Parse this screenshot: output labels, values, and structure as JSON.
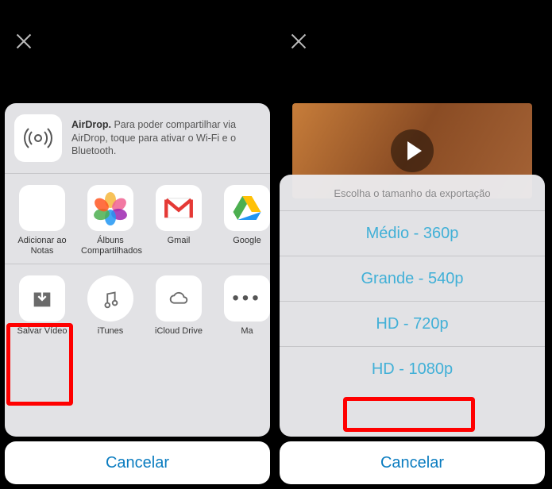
{
  "left": {
    "airdrop_bold": "AirDrop.",
    "airdrop_text": " Para poder compartilhar via AirDrop, toque para ativar o Wi-Fi e o Bluetooth.",
    "share_row": [
      {
        "name": "notes",
        "label": "Adicionar ao Notas"
      },
      {
        "name": "photos",
        "label": "Álbuns Compartilhados"
      },
      {
        "name": "gmail",
        "label": "Gmail"
      },
      {
        "name": "drive",
        "label": "Google"
      }
    ],
    "action_row": [
      {
        "name": "save-video",
        "label": "Salvar Vídeo"
      },
      {
        "name": "itunes",
        "label": "iTunes"
      },
      {
        "name": "icloud-drive",
        "label": "iCloud Drive"
      },
      {
        "name": "more",
        "label": "Ma"
      }
    ],
    "cancel": "Cancelar"
  },
  "right": {
    "export_header": "Escolha o tamanho da exportação",
    "options": [
      "Médio - 360p",
      "Grande - 540p",
      "HD - 720p",
      "HD - 1080p"
    ],
    "cancel": "Cancelar"
  },
  "colors": {
    "accent_blue": "#41b0d7",
    "cancel_text": "#0a7cc0",
    "highlight_red": "#ff0000"
  }
}
